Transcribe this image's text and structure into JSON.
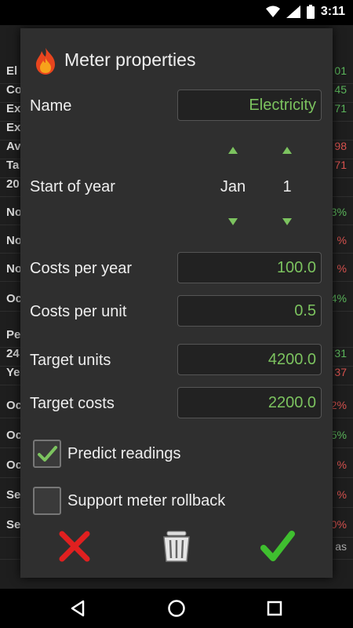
{
  "status_bar": {
    "time": "3:11"
  },
  "background_app": {
    "rows": [
      {
        "left": "El",
        "right": "01",
        "right_color": "green"
      },
      {
        "left": "Co",
        "right": "45",
        "right_color": "green"
      },
      {
        "left": "Ex",
        "right": "71",
        "right_color": "green"
      },
      {
        "left": "Ex",
        "right": "",
        "right_color": "green"
      },
      {
        "left": "Av",
        "right": "98",
        "right_color": "red"
      },
      {
        "left": "Ta",
        "right": "71",
        "right_color": "red"
      },
      {
        "left": "20",
        "right": "",
        "right_color": "green"
      },
      {
        "left": "No",
        "right": "3%",
        "right_color": "green"
      },
      {
        "left": "No",
        "right": "%",
        "right_color": "red"
      },
      {
        "left": "No",
        "right": "%",
        "right_color": "red"
      },
      {
        "left": "Oc",
        "right": "4%",
        "right_color": "green"
      },
      {
        "left": "Pe",
        "right": "",
        "right_color": "green"
      },
      {
        "left": "24",
        "right": "31",
        "right_color": "green"
      },
      {
        "left": "Ye",
        "right": "37",
        "right_color": "red"
      },
      {
        "left": "Oc",
        "right": "2%",
        "right_color": "red"
      },
      {
        "left": "Oc",
        "right": "5%",
        "right_color": "green"
      },
      {
        "left": "Oc",
        "right": "%",
        "right_color": "red"
      },
      {
        "left": "Se",
        "right": "%",
        "right_color": "red"
      },
      {
        "left": "Se",
        "right": "0%",
        "right_color": "red"
      },
      {
        "left": "",
        "right": "as",
        "right_color": "grey"
      }
    ]
  },
  "dialog": {
    "title": "Meter properties",
    "name_label": "Name",
    "name_value": "Electricity",
    "start_of_year_label": "Start of year",
    "start_month": "Jan",
    "start_day": "1",
    "costs_per_year_label": "Costs per year",
    "costs_per_year_value": "100.0",
    "costs_per_unit_label": "Costs per unit",
    "costs_per_unit_value": "0.5",
    "target_units_label": "Target units",
    "target_units_value": "4200.0",
    "target_costs_label": "Target costs",
    "target_costs_value": "2200.0",
    "predict_readings_label": "Predict readings",
    "predict_readings_checked": true,
    "rollback_label": "Support meter rollback",
    "rollback_checked": false,
    "icons": {
      "title": "flame-icon",
      "cancel": "cross-icon",
      "delete": "trash-icon",
      "confirm": "checkmark-icon"
    },
    "colors": {
      "value_green": "#7cc35f",
      "cancel_red": "#e02020",
      "confirm_green": "#3fbf2f"
    }
  }
}
